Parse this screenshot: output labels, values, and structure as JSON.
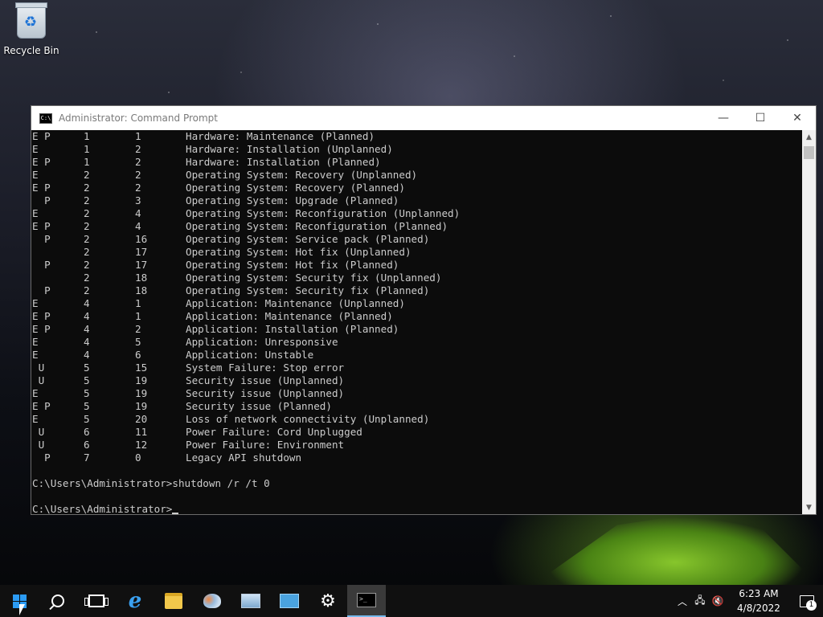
{
  "desktop": {
    "icons": [
      {
        "label": "Recycle Bin",
        "icon": "recycle-bin-icon"
      }
    ]
  },
  "window": {
    "title": "Administrator: Command Prompt",
    "controls": {
      "minimize": "—",
      "maximize": "☐",
      "close": "✕"
    },
    "rows": [
      {
        "flags": "E P",
        "major": "1",
        "minor": "1",
        "desc": "Hardware: Maintenance (Planned)"
      },
      {
        "flags": "E",
        "major": "1",
        "minor": "2",
        "desc": "Hardware: Installation (Unplanned)"
      },
      {
        "flags": "E P",
        "major": "1",
        "minor": "2",
        "desc": "Hardware: Installation (Planned)"
      },
      {
        "flags": "E",
        "major": "2",
        "minor": "2",
        "desc": "Operating System: Recovery (Unplanned)"
      },
      {
        "flags": "E P",
        "major": "2",
        "minor": "2",
        "desc": "Operating System: Recovery (Planned)"
      },
      {
        "flags": "  P",
        "major": "2",
        "minor": "3",
        "desc": "Operating System: Upgrade (Planned)"
      },
      {
        "flags": "E",
        "major": "2",
        "minor": "4",
        "desc": "Operating System: Reconfiguration (Unplanned)"
      },
      {
        "flags": "E P",
        "major": "2",
        "minor": "4",
        "desc": "Operating System: Reconfiguration (Planned)"
      },
      {
        "flags": "  P",
        "major": "2",
        "minor": "16",
        "desc": "Operating System: Service pack (Planned)"
      },
      {
        "flags": "",
        "major": "2",
        "minor": "17",
        "desc": "Operating System: Hot fix (Unplanned)"
      },
      {
        "flags": "  P",
        "major": "2",
        "minor": "17",
        "desc": "Operating System: Hot fix (Planned)"
      },
      {
        "flags": "",
        "major": "2",
        "minor": "18",
        "desc": "Operating System: Security fix (Unplanned)"
      },
      {
        "flags": "  P",
        "major": "2",
        "minor": "18",
        "desc": "Operating System: Security fix (Planned)"
      },
      {
        "flags": "E",
        "major": "4",
        "minor": "1",
        "desc": "Application: Maintenance (Unplanned)"
      },
      {
        "flags": "E P",
        "major": "4",
        "minor": "1",
        "desc": "Application: Maintenance (Planned)"
      },
      {
        "flags": "E P",
        "major": "4",
        "minor": "2",
        "desc": "Application: Installation (Planned)"
      },
      {
        "flags": "E",
        "major": "4",
        "minor": "5",
        "desc": "Application: Unresponsive"
      },
      {
        "flags": "E",
        "major": "4",
        "minor": "6",
        "desc": "Application: Unstable"
      },
      {
        "flags": " U",
        "major": "5",
        "minor": "15",
        "desc": "System Failure: Stop error"
      },
      {
        "flags": " U",
        "major": "5",
        "minor": "19",
        "desc": "Security issue (Unplanned)"
      },
      {
        "flags": "E",
        "major": "5",
        "minor": "19",
        "desc": "Security issue (Unplanned)"
      },
      {
        "flags": "E P",
        "major": "5",
        "minor": "19",
        "desc": "Security issue (Planned)"
      },
      {
        "flags": "E",
        "major": "5",
        "minor": "20",
        "desc": "Loss of network connectivity (Unplanned)"
      },
      {
        "flags": " U",
        "major": "6",
        "minor": "11",
        "desc": "Power Failure: Cord Unplugged"
      },
      {
        "flags": " U",
        "major": "6",
        "minor": "12",
        "desc": "Power Failure: Environment"
      },
      {
        "flags": "  P",
        "major": "7",
        "minor": "0",
        "desc": "Legacy API shutdown"
      }
    ],
    "command_line": "C:\\Users\\Administrator>shutdown /r /t 0",
    "prompt": "C:\\Users\\Administrator>"
  },
  "taskbar": {
    "items": [
      {
        "name": "start-button",
        "icon": "windows-logo-icon"
      },
      {
        "name": "search-button",
        "icon": "search-icon"
      },
      {
        "name": "task-view-button",
        "icon": "task-view-icon"
      },
      {
        "name": "internet-explorer-button",
        "icon": "internet-explorer-icon"
      },
      {
        "name": "file-explorer-button",
        "icon": "folder-icon"
      },
      {
        "name": "paint-button",
        "icon": "paint-icon"
      },
      {
        "name": "server-manager-button",
        "icon": "server-manager-icon"
      },
      {
        "name": "remote-desktop-button",
        "icon": "remote-desktop-icon"
      },
      {
        "name": "settings-button",
        "icon": "gear-icon"
      },
      {
        "name": "command-prompt-button",
        "icon": "command-prompt-icon",
        "active": true
      }
    ],
    "tray": {
      "time": "6:23 AM",
      "date": "4/8/2022",
      "notification_count": "1"
    },
    "accent": "#76b9ed"
  }
}
